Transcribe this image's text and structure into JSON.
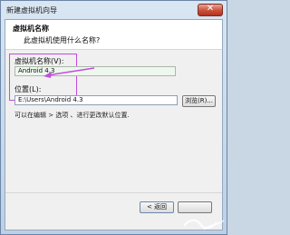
{
  "window": {
    "title": "新建虚拟机向导",
    "close_glyph": "✕"
  },
  "header": {
    "title": "虚拟机名称",
    "description": "此虚拟机使用什么名称?"
  },
  "name_field": {
    "label": "虚拟机名称(V):",
    "value": "Android 4.3"
  },
  "location_field": {
    "label": "位置(L):",
    "value": "E:\\Users\\Android 4.3",
    "browse_label": "浏览(R)..."
  },
  "hint": "可以在编辑 > 选项 、进行更改默认位置.",
  "footer": {
    "back_label": "< 返回"
  },
  "colors": {
    "annotation": "#c34ce0",
    "close_button": "#c9503a"
  },
  "icons": {
    "close": "close-icon",
    "arrow": "annotation-arrow-icon"
  }
}
